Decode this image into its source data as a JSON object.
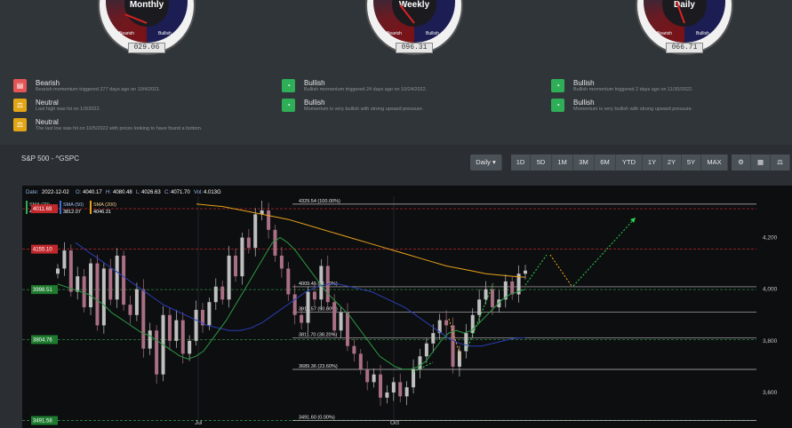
{
  "gauges": [
    {
      "title": "Monthly",
      "bearish": "Bearish",
      "bullish": "Bullish",
      "value": "029.06"
    },
    {
      "title": "Weekly",
      "bearish": "Bearish",
      "bullish": "Bullish",
      "value": "096.31"
    },
    {
      "title": "Daily",
      "bearish": "Bearish",
      "bullish": "Bullish",
      "value": "066.71"
    }
  ],
  "signals": {
    "monthly": [
      {
        "name": "Bearish",
        "desc": "Bearish momentum triggered 277 days ago on 10/4/2021.",
        "color": "#e45656",
        "icon": "chat-icon"
      },
      {
        "name": "Neutral",
        "desc": "Last high was hit on 1/3/2022.",
        "color": "#e2a516",
        "icon": "scale-icon"
      },
      {
        "name": "Neutral",
        "desc": "The last low was hit on 10/5/2022 with prices looking to have found a bottom.",
        "color": "#e2a516",
        "icon": "scale-icon"
      }
    ],
    "weekly": [
      {
        "name": "Bullish",
        "desc": "Bullish momentum triggered 24 days ago on 10/24/2022.",
        "color": "#2fae58",
        "icon": "speedometer-icon"
      },
      {
        "name": "Bullish",
        "desc": "Momentum is very bullish with strong upward pressure.",
        "color": "#2fae58",
        "icon": "speedometer-icon"
      }
    ],
    "daily": [
      {
        "name": "Bullish",
        "desc": "Bullish momentum triggered 2 days ago on 11/30/2022.",
        "color": "#2fae58",
        "icon": "speedometer-icon"
      },
      {
        "name": "Bullish",
        "desc": "Momentum is very bullish with strong upward pressure.",
        "color": "#2fae58",
        "icon": "speedometer-icon"
      }
    ]
  },
  "chart_panel": {
    "title": "S&P 500 - ^GSPC",
    "interval": "Daily",
    "ranges": [
      "1D",
      "5D",
      "1M",
      "3M",
      "6M",
      "YTD",
      "1Y",
      "2Y",
      "5Y",
      "MAX"
    ],
    "tool_icons": [
      "indicators-icon",
      "calculator-icon",
      "balance-icon"
    ]
  },
  "ohlc": {
    "date_label": "Date:",
    "date": "2022-12-02",
    "o_label": "O:",
    "o": "4040.17",
    "h_label": "H:",
    "h": "4080.48",
    "l_label": "L:",
    "l": "4026.63",
    "c_label": "C:",
    "c": "4071.70",
    "vol_label": "Vol:",
    "vol": "4.013G"
  },
  "sma_legend": [
    {
      "label": "SMA (20)",
      "value": "4011.69",
      "color": "#2fae58"
    },
    {
      "label": "SMA (50)",
      "value": "3812.07",
      "color": "#3b6fd8"
    },
    {
      "label": "SMA (200)",
      "value": "4046.31",
      "color": "#e7a21a"
    }
  ],
  "price_tags": [
    {
      "value": "4155.10",
      "color": "#c0282c"
    },
    {
      "value": "3998.51",
      "color": "#1e7a2e"
    },
    {
      "value": "3804.76",
      "color": "#1e7a2e"
    },
    {
      "value": "3491.58",
      "color": "#1e7a2e"
    }
  ],
  "fib_levels": [
    {
      "label": "4329.54 (100.00%)",
      "price": 4329.54
    },
    {
      "label": "4009.45 (61.80%)",
      "price": 4009.45
    },
    {
      "label": "3910.57 (50.00%)",
      "price": 3910.57
    },
    {
      "label": "3811.70 (38.20%)",
      "price": 3811.7
    },
    {
      "label": "3689.36 (23.60%)",
      "price": 3689.36
    },
    {
      "label": "3491.60 (0.00%)",
      "price": 3491.6
    }
  ],
  "chart_data": {
    "type": "candlestick",
    "y_ticks": [
      "4,200",
      "4,000",
      "3,800",
      "3,600"
    ],
    "y_tick_values": [
      4200,
      4000,
      3800,
      3600
    ],
    "x_labels": [
      "Jul",
      "Oct"
    ],
    "ylim": [
      3490,
      4360
    ],
    "resistance_lines": [
      4311.69,
      4155.1
    ],
    "support_lines": [
      3998.51,
      3804.76,
      3491.58
    ],
    "close_path": [
      4080,
      4150,
      3990,
      4050,
      3930,
      4100,
      3860,
      4080,
      3960,
      4130,
      3940,
      3900,
      4000,
      3770,
      3840,
      3670,
      3900,
      3800,
      3880,
      3750,
      3800,
      3920,
      3860,
      3950,
      4010,
      3960,
      4130,
      4050,
      4200,
      4160,
      4290,
      4305,
      4230,
      4130,
      4080,
      3980,
      3900,
      3870,
      3990,
      3960,
      4090,
      3950,
      3840,
      3910,
      3780,
      3750,
      3690,
      3640,
      3670,
      3580,
      3600,
      3640,
      3585,
      3620,
      3690,
      3740,
      3790,
      3830,
      3880,
      3860,
      3700,
      3760,
      3830,
      3900,
      3960,
      4000,
      3930,
      3960,
      4030,
      3980,
      4060,
      4072
    ],
    "sma20": [
      4020,
      4010,
      4000,
      3990,
      3980,
      3960,
      3940,
      3910,
      3890,
      3870,
      3850,
      3830,
      3820,
      3800,
      3780,
      3760,
      3740,
      3730,
      3740,
      3760,
      3800,
      3840,
      3880,
      3930,
      3980,
      4030,
      4080,
      4130,
      4180,
      4200,
      4180,
      4150,
      4110,
      4070,
      4030,
      3990,
      3960,
      3930,
      3900,
      3860,
      3820,
      3780,
      3740,
      3720,
      3700,
      3690,
      3690,
      3700,
      3720,
      3760,
      3800,
      3830,
      3840,
      3830,
      3840,
      3870,
      3900,
      3930,
      3960,
      3980,
      3990,
      4000
    ],
    "sma50": [
      4180,
      4150,
      4120,
      4090,
      4060,
      4030,
      4000,
      3970,
      3940,
      3920,
      3900,
      3880,
      3860,
      3850,
      3840,
      3840,
      3850,
      3870,
      3900,
      3930,
      3960,
      3990,
      4010,
      4020,
      4020,
      4010,
      4000,
      3990,
      3970,
      3950,
      3930,
      3900,
      3870,
      3840,
      3810,
      3790,
      3780,
      3780,
      3790,
      3800,
      3810,
      3812
    ],
    "sma200": [
      4330,
      4325,
      4320,
      4310,
      4300,
      4290,
      4280,
      4270,
      4255,
      4240,
      4225,
      4210,
      4195,
      4180,
      4165,
      4150,
      4135,
      4120,
      4105,
      4090,
      4080,
      4070,
      4060,
      4055,
      4050,
      4046
    ]
  }
}
